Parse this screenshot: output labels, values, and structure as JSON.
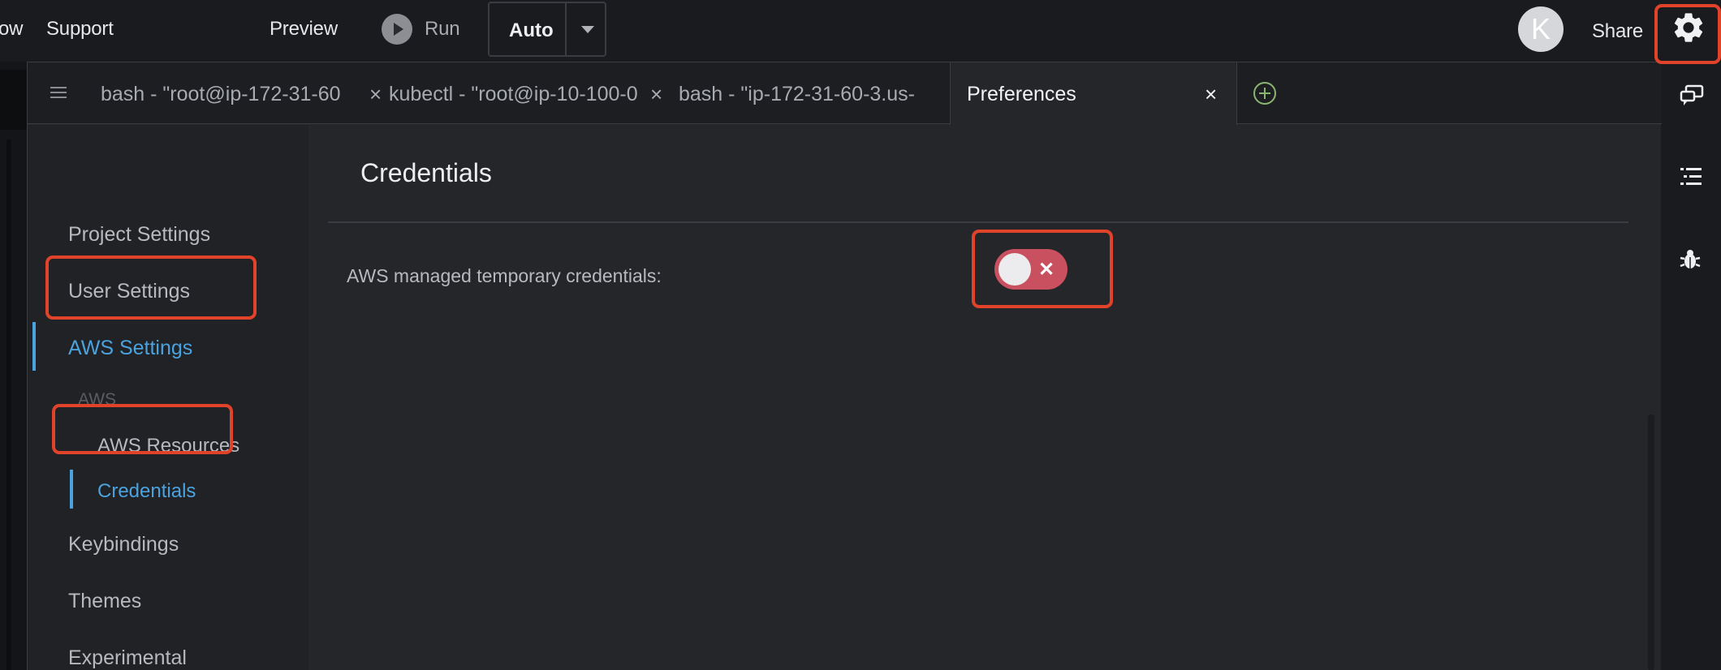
{
  "topbar": {
    "menu_partial": "ow",
    "support_label": "Support",
    "preview_label": "Preview",
    "run_label": "Run",
    "auto_label": "Auto",
    "avatar_initial": "K",
    "share_label": "Share"
  },
  "tabs": [
    {
      "label": "bash - \"root@ip-172-31-60",
      "close": "×"
    },
    {
      "label": "kubectl - \"root@ip-10-100-0",
      "close": "×"
    },
    {
      "label": "bash - \"ip-172-31-60-3.us-",
      "close": "×"
    },
    {
      "label": "Preferences",
      "close": "×",
      "active": true
    }
  ],
  "sidebar": {
    "items": [
      {
        "label": "Project Settings"
      },
      {
        "label": "User Settings"
      },
      {
        "label": "AWS Settings",
        "active": true
      },
      {
        "label": "Keybindings"
      },
      {
        "label": "Themes"
      },
      {
        "label": "Experimental"
      }
    ],
    "group_label": "AWS",
    "subitems": [
      {
        "label": "AWS Resources"
      },
      {
        "label": "Credentials",
        "active": true
      }
    ]
  },
  "content": {
    "title": "Credentials",
    "settings": [
      {
        "label": "AWS managed temporary credentials:",
        "toggle_on": false,
        "toggle_glyph": "✕"
      }
    ]
  },
  "icons": [
    "gear-icon",
    "chat-icon",
    "outline-icon",
    "debug-bug-icon",
    "play-icon",
    "caret-down-icon",
    "add-tab-icon",
    "hamburger-icon"
  ],
  "colors": {
    "accent": "#4aa3df",
    "toggle_off": "#c8505f",
    "highlight": "#e0432a",
    "add_tab": "#8ab56f"
  }
}
